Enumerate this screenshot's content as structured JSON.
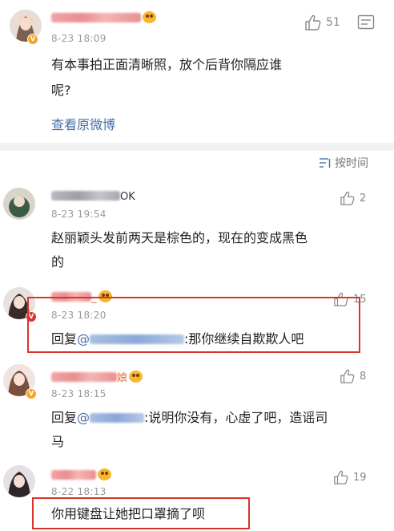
{
  "post": {
    "time": "8-23 18:09",
    "likes": "51",
    "text_line1": "有本事拍正面清晰照，放个后背你隔应谁",
    "text_line2": "呢?",
    "view_original": "查看原微博"
  },
  "sort": {
    "label": "按时间",
    "icon": "sort-lines-icon"
  },
  "comments": [
    {
      "name_suffix": "OK",
      "time": "8-23 19:54",
      "likes": "2",
      "text_line1": "赵丽颖头发前两天是棕色的，现在的变成黑色",
      "text_line2": "的"
    },
    {
      "name_suffix": "_",
      "time": "8-23 18:20",
      "likes": "15",
      "reply_prefix": "回复",
      "reply_text": ":那你继续自欺欺人吧"
    },
    {
      "name_suffix": "娘",
      "time": "8-23 18:15",
      "likes": "8",
      "reply_prefix": "回复",
      "reply_text": ":说明你没有，心虚了吧，造谣司",
      "text_line2": "马"
    },
    {
      "name_suffix": "",
      "time": "8-22 18:13",
      "likes": "19",
      "text_line1": "你用键盘让她把口罩摘了呗"
    }
  ],
  "colors": {
    "highlight_box": "#d8352a",
    "link": "#4a6fa5",
    "username": "#e8663a"
  }
}
